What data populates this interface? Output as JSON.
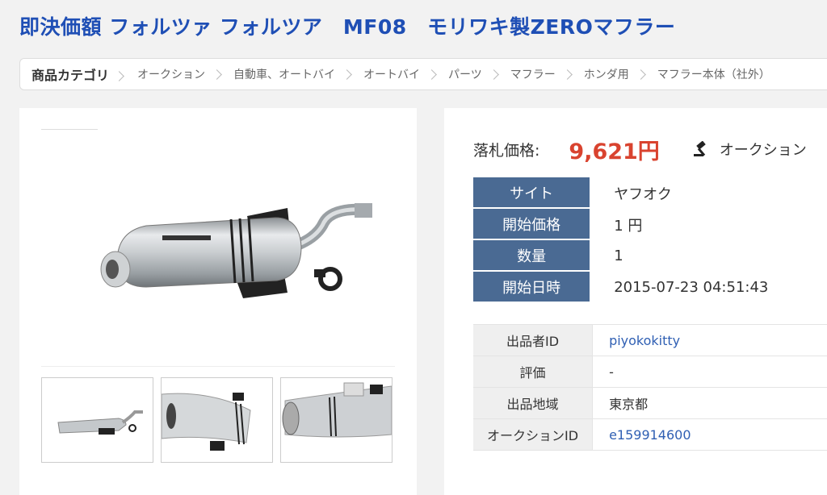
{
  "title": "即決価額 フォルツァ フォルツア　MF08　モリワキ製ZEROマフラー",
  "breadcrumb": {
    "head": "商品カテゴリ",
    "items": [
      "オークション",
      "自動車、オートバイ",
      "オートバイ",
      "パーツ",
      "マフラー",
      "ホンダ用",
      "マフラー本体（社外）"
    ]
  },
  "price": {
    "label": "落札価格:",
    "value": "9,621円",
    "auction_link": "オークション",
    "accent_color": "#d9432f"
  },
  "info": [
    {
      "key": "サイト",
      "value": "ヤフオク"
    },
    {
      "key": "開始価格",
      "value": "1 円"
    },
    {
      "key": "数量",
      "value": "1"
    },
    {
      "key": "開始日時",
      "value": "2015-07-23 04:51:43"
    }
  ],
  "seller": [
    {
      "key": "出品者ID",
      "value": "piyokokitty"
    },
    {
      "key": "評価",
      "value": "-"
    },
    {
      "key": "出品地域",
      "value": "東京都"
    },
    {
      "key": "オークションID",
      "value": "e159914600"
    }
  ],
  "icons": {
    "auction": "gavel-icon"
  }
}
